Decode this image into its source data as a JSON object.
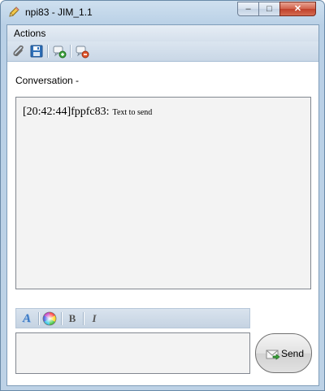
{
  "window": {
    "title": "npi83 - JIM_1.1",
    "controls": {
      "minimize": "–",
      "maximize": "□",
      "close": "✕"
    }
  },
  "menu": {
    "actions_label": "Actions"
  },
  "toolbar": {
    "icons": [
      "attach-icon",
      "save-icon",
      "add-contact-icon",
      "remove-contact-icon"
    ]
  },
  "conversation": {
    "label": "Conversation -",
    "messages": [
      {
        "time": "[20:42:44]",
        "user": "fppfc83:",
        "text": "Text to send"
      }
    ]
  },
  "format_bar": {
    "font_icon": "A",
    "color_icon": "color-wheel-icon",
    "bold": "B",
    "italic": "I"
  },
  "input": {
    "value": ""
  },
  "send": {
    "label": "Send"
  },
  "colors": {
    "frame": "#bcd2e7",
    "close_button": "#c9503a",
    "font_icon": "#3a78c4"
  }
}
